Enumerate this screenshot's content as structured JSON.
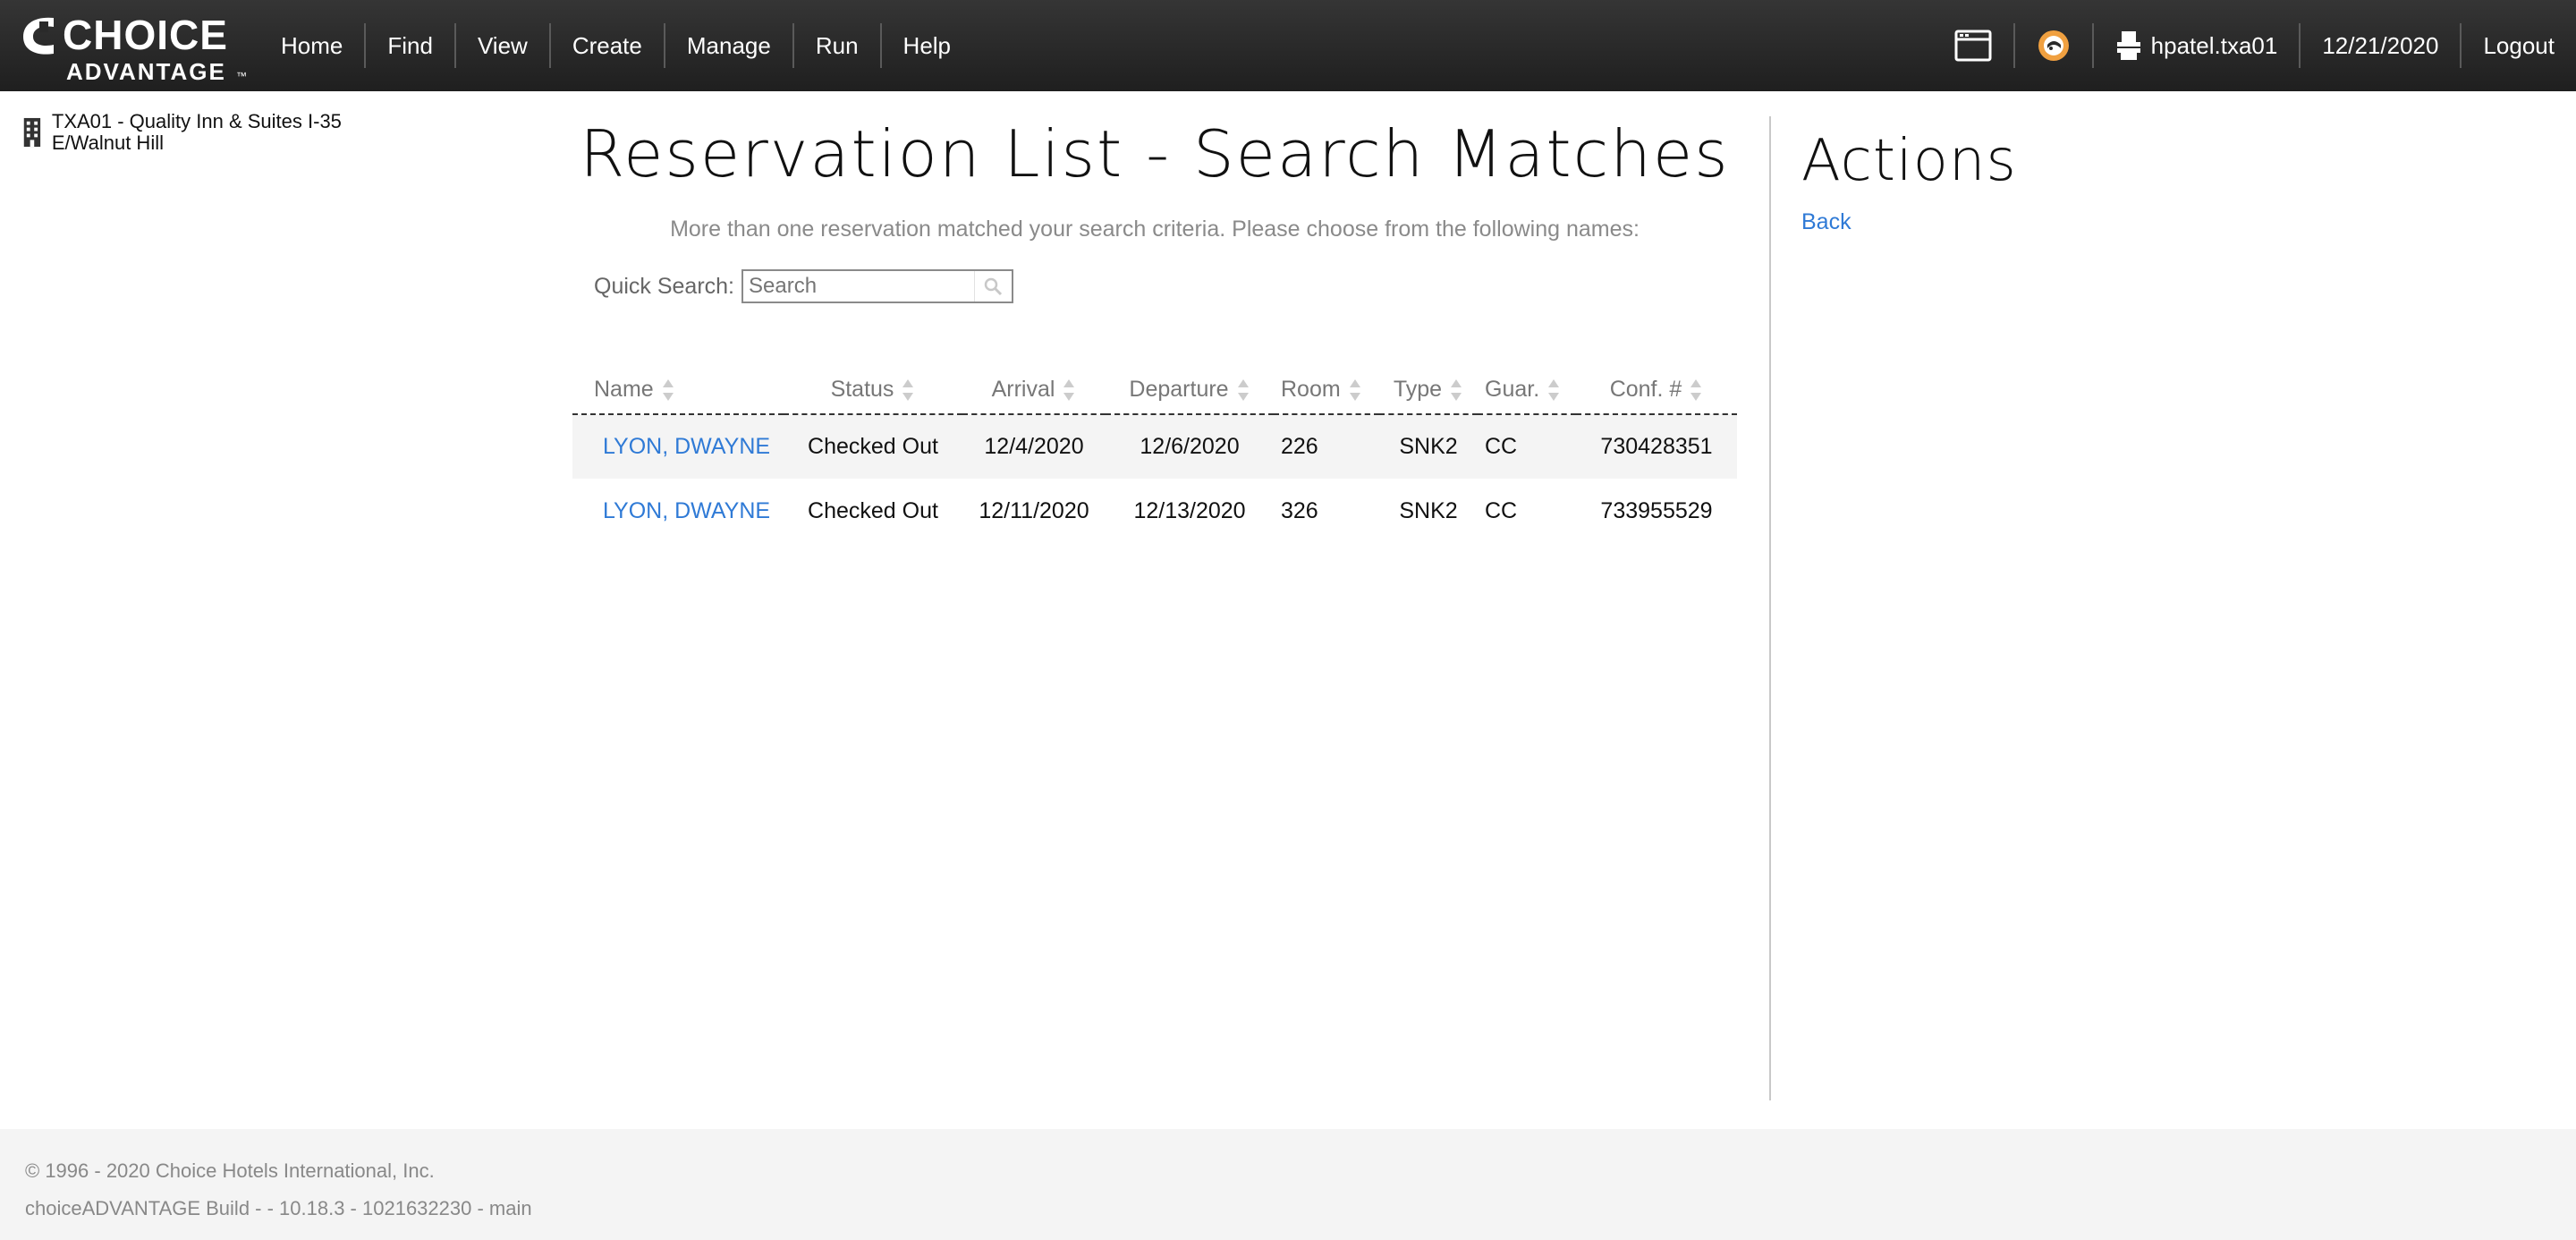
{
  "header": {
    "logo": {
      "line1": "CHOICE",
      "line2": "ADVANTAGE",
      "tm": "™"
    },
    "nav": [
      "Home",
      "Find",
      "View",
      "Create",
      "Manage",
      "Run",
      "Help"
    ],
    "user": "hpatel.txa01",
    "date": "12/21/2020",
    "logout": "Logout",
    "icons": [
      "window-icon",
      "chat-support-icon",
      "printer-user-icon"
    ]
  },
  "hotel": {
    "name": "TXA01 - Quality Inn & Suites I-35 E/Walnut Hill",
    "icon": "building-icon"
  },
  "main": {
    "title": "Reservation List - Search Matches",
    "subtitle": "More than one reservation matched your search criteria. Please choose from the following names:",
    "quick_search": {
      "label": "Quick Search:",
      "placeholder": "Search"
    },
    "table": {
      "columns": [
        "Name",
        "Status",
        "Arrival",
        "Departure",
        "Room",
        "Type",
        "Guar.",
        "Conf. #"
      ],
      "rows": [
        [
          "LYON, DWAYNE",
          "Checked Out",
          "12/4/2020",
          "12/6/2020",
          "226",
          "SNK2",
          "CC",
          "730428351"
        ],
        [
          "LYON, DWAYNE",
          "Checked Out",
          "12/11/2020",
          "12/13/2020",
          "326",
          "SNK2",
          "CC",
          "733955529"
        ]
      ]
    }
  },
  "actions": {
    "title": "Actions",
    "back": "Back"
  },
  "footer": {
    "copyright": "© 1996 - 2020 Choice Hotels International, Inc.",
    "build": "choiceADVANTAGE Build - - 10.18.3 - 1021632230 - main"
  },
  "colors": {
    "link": "#2f7ad6",
    "topbar": "#2a2a2a",
    "row_alt": "#f4f4f4",
    "chat_icon": "#f0a040"
  }
}
